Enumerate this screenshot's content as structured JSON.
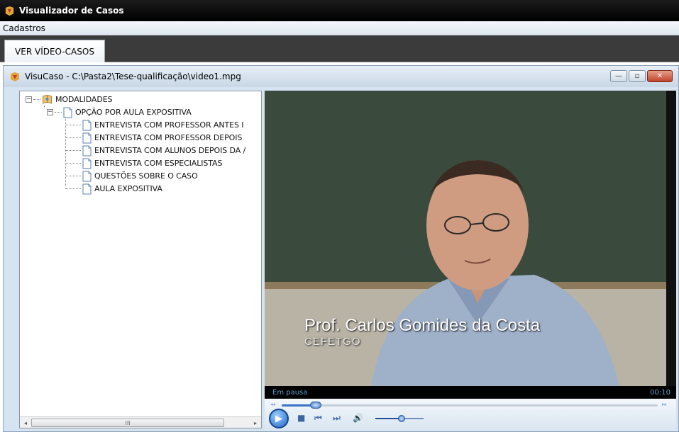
{
  "app": {
    "title": "Visualizador de Casos",
    "menu": [
      "Cadastros"
    ],
    "tabs": [
      {
        "label": "VER VÍDEO-CASOS"
      }
    ]
  },
  "child_window": {
    "title": "VisuCaso - C:\\Pasta2\\Tese-qualificação\\video1.mpg",
    "controls": {
      "minimize": "—",
      "maximize": "▫",
      "close": "✕"
    }
  },
  "tree": {
    "root": "MODALIDADES",
    "group": "OPÇÃO POR AULA EXPOSITIVA",
    "items": [
      "ENTREVISTA COM PROFESSOR ANTES I",
      "ENTREVISTA COM PROFESSOR DEPOIS",
      "ENTREVISTA COM ALUNOS DEPOIS DA /",
      "ENTREVISTA COM ESPECIALISTAS",
      "QUESTÕES SOBRE O CASO",
      "AULA EXPOSITIVA"
    ],
    "expander_minus": "−",
    "scroll_left": "◂",
    "scroll_right": "▸",
    "scroll_thumb_grip": "III"
  },
  "player": {
    "caption_name": "Prof. Carlos Gomides da Costa",
    "caption_org": "CEFETGO",
    "status": "Em pausa",
    "time": "00:10",
    "seek_progress": 0.09,
    "volume_level": 0.55,
    "glyphs": {
      "play": "▶",
      "stop": "■",
      "prev": "⏮",
      "next": "⏭",
      "volume": "🔊",
      "seek_back": "◂◂",
      "seek_fwd": "▸▸"
    }
  },
  "colors": {
    "titlebar": "#000000",
    "tabstrip": "#3b3b3b",
    "child_bg": "#d6e3f0",
    "accent_blue": "#3a73c4",
    "status_text": "#5f9ec9"
  }
}
